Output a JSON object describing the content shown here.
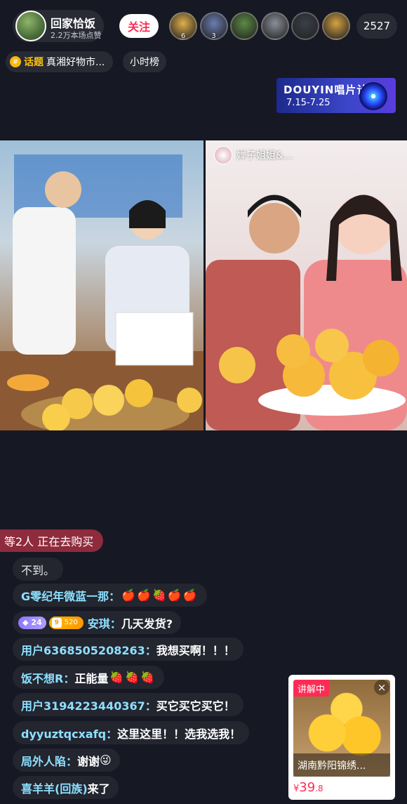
{
  "header": {
    "host_name": "回家恰饭",
    "likes_text": "2.2万本场点赞",
    "follow_label": "关注",
    "viewers": [
      {
        "badge": "6",
        "color": "#e0b04a"
      },
      {
        "badge": "3",
        "color": "#6b7db0"
      },
      {
        "badge": "",
        "color": "#5c8a44"
      },
      {
        "badge": "",
        "color": "#8a8f98"
      },
      {
        "badge": "",
        "color": "#3a4048"
      },
      {
        "badge": "",
        "color": "#d6a241"
      }
    ],
    "viewer_count": "2527"
  },
  "topic": {
    "tag_label": "话题",
    "text": "真湘好物市...",
    "hour_rank_label": "小时榜"
  },
  "banner": {
    "title": "DOUYIN唱片计划",
    "date": "7.15-7.25"
  },
  "guest": {
    "name": "婵子姐姐&..."
  },
  "purchase_notice": "等2人 正在去购买",
  "comments": [
    {
      "user": "",
      "text": "不到。",
      "style": "plain"
    },
    {
      "user": "G零纪年微蓝一那：",
      "text": "",
      "emoji": "🍎🍎🍓🍎🍎"
    },
    {
      "user": "安琪：",
      "text": "几天发货?",
      "fan_level": "24",
      "user_level": "9",
      "user_level_extra": "520"
    },
    {
      "user": "用户6368505208263：",
      "text": "我想买啊！！！"
    },
    {
      "user": "饭不想R：",
      "text": "正能量",
      "emoji": "🍓🍓🍓"
    },
    {
      "user": "用户3194223440367：",
      "text": "买它买它买它！"
    },
    {
      "user": "dyyuztqcxafq：",
      "text": "这里这里！！选我选我！"
    },
    {
      "user": "局外人陷：",
      "text": "谢谢",
      "emoji": "😜"
    },
    {
      "user": "喜羊羊(回族)",
      "text": " 来了",
      "style": "join"
    }
  ],
  "product": {
    "explain_label": "讲解中",
    "close_symbol": "×",
    "title": "湖南黔阳锦绣...",
    "price_symbol": "¥",
    "price_int": "39",
    "price_dec": ".8"
  }
}
